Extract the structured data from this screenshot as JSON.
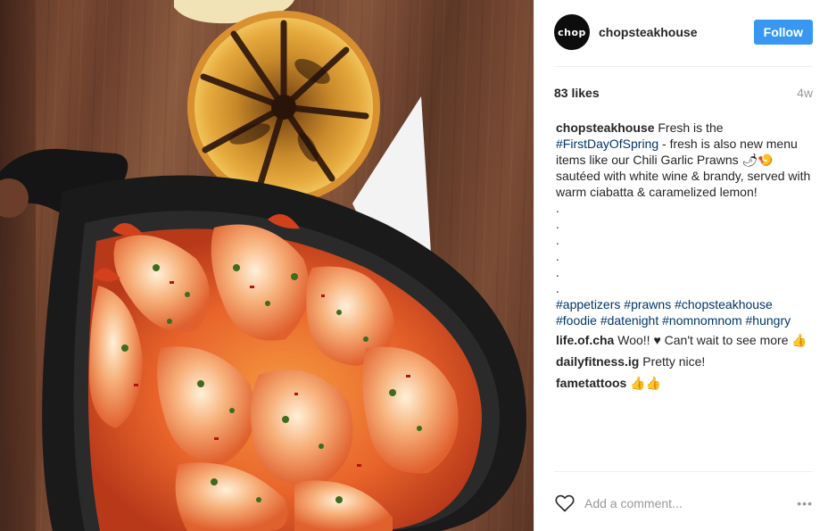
{
  "post": {
    "username": "chopsteakhouse",
    "avatar_text": "chop",
    "follow_label": "Follow",
    "likes": "83 likes",
    "time_ago": "4w",
    "caption": {
      "username": "chopsteakhouse",
      "text_1": " Fresh is the ",
      "hashtag_1": "#FirstDayOfSpring",
      "text_2": " - fresh is also new menu items like our Chili Garlic Prawns 🌶🍤 sautéed with white wine & brandy, served with warm ciabatta & caramelized lemon!",
      "dots": [
        ".",
        ".",
        ".",
        ".",
        ".",
        "."
      ],
      "hashtags": [
        "#appetizers",
        "#prawns",
        "#chopsteakhouse",
        "#foodie",
        "#datenight",
        "#nomnomnom",
        "#hungry"
      ]
    },
    "comments": [
      {
        "username": "life.of.cha",
        "text": " Woo!! ♥ Can't wait to see more 👍"
      },
      {
        "username": "dailyfitness.ig",
        "text": " Pretty nice!"
      },
      {
        "username": "fametattoos",
        "text": " 👍👍"
      }
    ],
    "add_comment_placeholder": "Add a comment...",
    "more_label": "•••"
  },
  "colors": {
    "follow_button": "#3897f0",
    "hashtag": "#003569",
    "muted": "#999999"
  },
  "icons": {
    "like": "heart-outline-icon",
    "more": "more-options-icon"
  }
}
